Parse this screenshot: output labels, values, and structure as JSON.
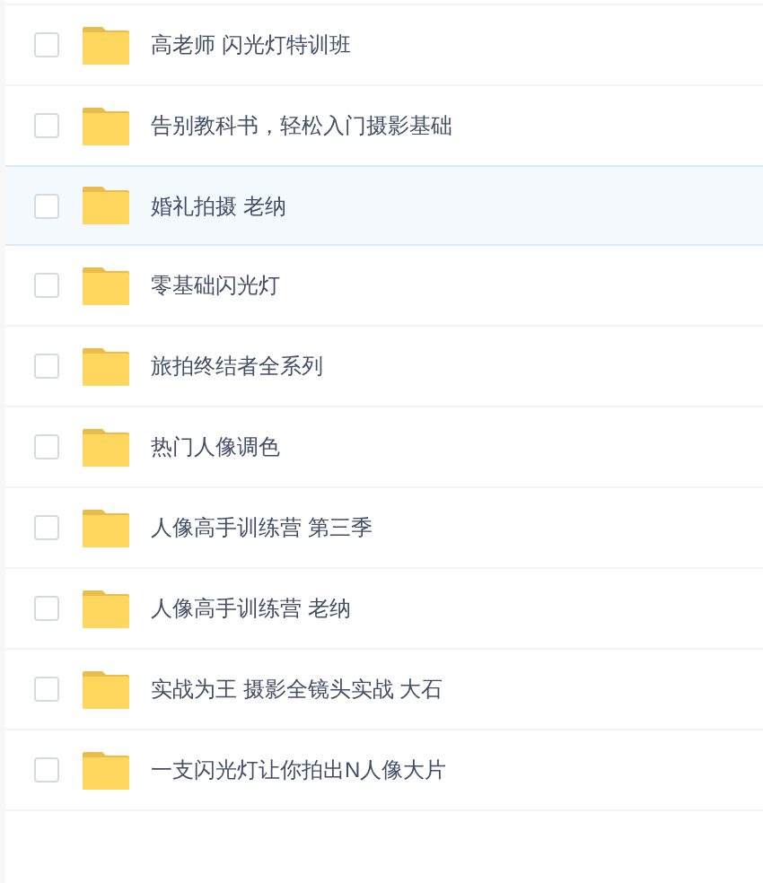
{
  "folders": [
    {
      "name": "高老师 闪光灯特训班",
      "checked": false,
      "highlighted": false
    },
    {
      "name": "告别教科书，轻松入门摄影基础",
      "checked": false,
      "highlighted": false
    },
    {
      "name": "婚礼拍摄 老纳",
      "checked": false,
      "highlighted": true
    },
    {
      "name": "零基础闪光灯",
      "checked": false,
      "highlighted": false
    },
    {
      "name": "旅拍终结者全系列",
      "checked": false,
      "highlighted": false
    },
    {
      "name": "热门人像调色",
      "checked": false,
      "highlighted": false
    },
    {
      "name": "人像高手训练营 第三季",
      "checked": false,
      "highlighted": false
    },
    {
      "name": "人像高手训练营 老纳",
      "checked": false,
      "highlighted": false
    },
    {
      "name": "实战为王 摄影全镜头实战 大石",
      "checked": false,
      "highlighted": false
    },
    {
      "name": "一支闪光灯让你拍出N人像大片",
      "checked": false,
      "highlighted": false
    }
  ]
}
